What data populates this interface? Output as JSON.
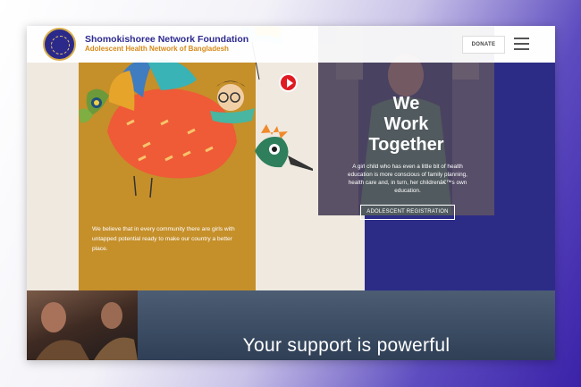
{
  "header": {
    "org_name": "Shomokishoree Network Foundation",
    "org_subtitle": "Adolescent Health Network of Bangladesh",
    "donate_label": "DONATE"
  },
  "hero": {
    "title_line1": "We",
    "title_line2": "Work",
    "title_line3": "Together",
    "text": "A girl child who has even a little bit of health education is more conscious of family planning, health care and, in turn, her childrenâ€™s own education.",
    "registration_label": "ADOLESCENT REGISTRATION"
  },
  "mission": {
    "text": "We believe that in every community there are girls with untapped potential ready to make our country a better place."
  },
  "support": {
    "title": "Your support is powerful"
  },
  "colors": {
    "brand_blue": "#2d2a8f",
    "brand_orange": "#d78a1a",
    "mustard": "#c58f2a",
    "navy": "#2c2c87",
    "play_red": "#e01b22"
  }
}
